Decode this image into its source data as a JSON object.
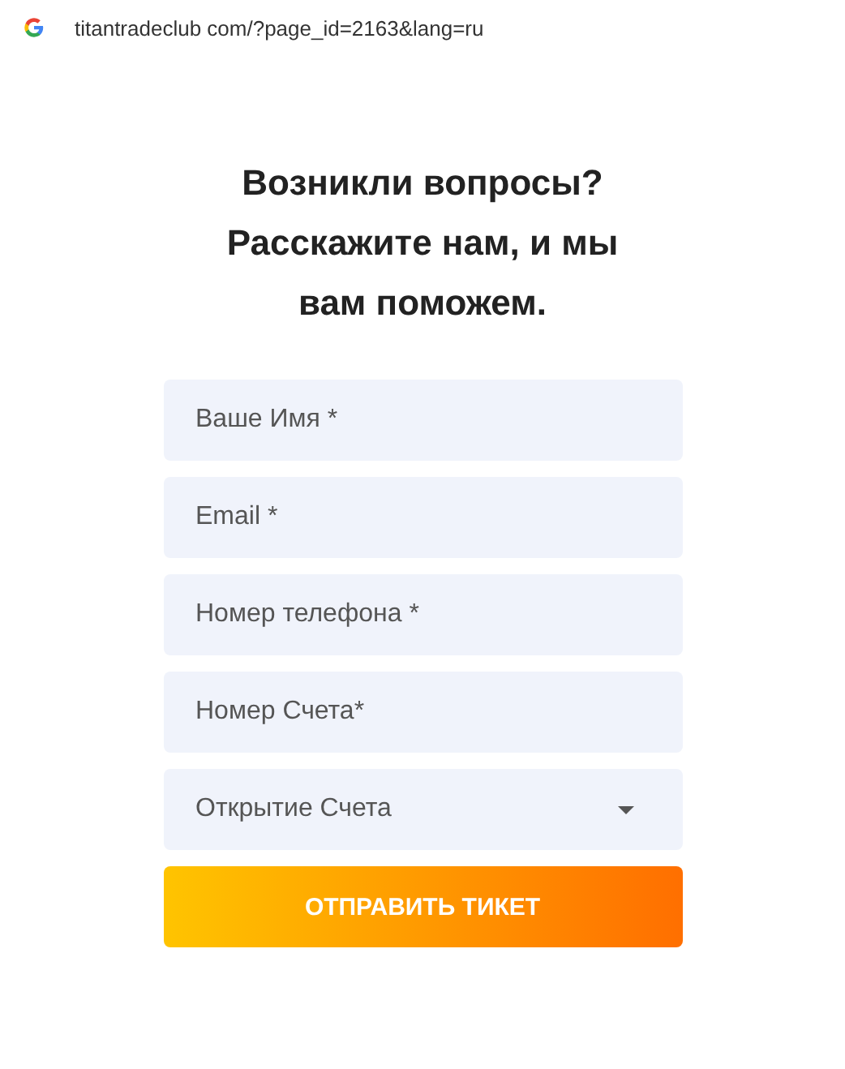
{
  "address_bar": {
    "url": "titantradeclub com/?page_id=2163&lang=ru"
  },
  "heading": [
    "Возникли вопросы?",
    "Расскажите нам, и мы",
    "вам поможем."
  ],
  "fields": [
    {
      "kind": "input",
      "placeholder": "Ваше Имя *"
    },
    {
      "kind": "input",
      "placeholder": "Email *"
    },
    {
      "kind": "input",
      "placeholder": "Номер телефона *"
    },
    {
      "kind": "input",
      "placeholder": "Номер Счета*"
    },
    {
      "kind": "select",
      "value": "Открытие Счета"
    }
  ],
  "submit_button": "ОТПРАВИТЬ ТИКЕТ"
}
